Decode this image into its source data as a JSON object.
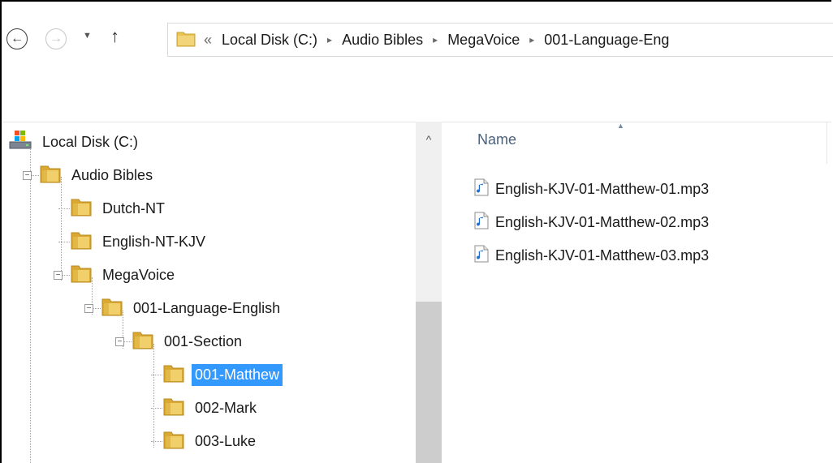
{
  "address_bar": {
    "overflow_chevron": "«",
    "crumbs": [
      "Local Disk (C:)",
      "Audio Bibles",
      "MegaVoice",
      "001-Language-Eng"
    ],
    "separator": "›"
  },
  "icons": {
    "back": "back-arrow-icon",
    "forward": "forward-arrow-icon",
    "recent": "chevron-down-icon",
    "up": "up-arrow-icon",
    "folder": "folder-icon",
    "drive": "drive-icon",
    "audio_file": "audio-file-icon"
  },
  "nav_tree": [
    {
      "label": "Local Disk (C:)",
      "level": 0,
      "type": "drive",
      "expander": "",
      "selected": false
    },
    {
      "label": "Audio Bibles",
      "level": 1,
      "type": "folder",
      "expander": "−",
      "selected": false
    },
    {
      "label": "Dutch-NT",
      "level": 2,
      "type": "folder",
      "expander": "",
      "selected": false
    },
    {
      "label": "English-NT-KJV",
      "level": 2,
      "type": "folder",
      "expander": "",
      "selected": false
    },
    {
      "label": "MegaVoice",
      "level": 2,
      "type": "folder",
      "expander": "−",
      "selected": false
    },
    {
      "label": "001-Language-English",
      "level": 3,
      "type": "folder",
      "expander": "−",
      "selected": false
    },
    {
      "label": "001-Section",
      "level": 4,
      "type": "folder",
      "expander": "−",
      "selected": false
    },
    {
      "label": "001-Matthew",
      "level": 5,
      "type": "folder",
      "expander": "",
      "selected": true
    },
    {
      "label": "002-Mark",
      "level": 5,
      "type": "folder",
      "expander": "",
      "selected": false
    },
    {
      "label": "003-Luke",
      "level": 5,
      "type": "folder",
      "expander": "",
      "selected": false
    }
  ],
  "file_list": {
    "column_header": "Name",
    "files": [
      "English-KJV-01-Matthew-01.mp3",
      "English-KJV-01-Matthew-02.mp3",
      "English-KJV-01-Matthew-03.mp3"
    ]
  },
  "colors": {
    "selection": "#3399ff",
    "folder": "#e8c252",
    "header_text": "#4c607a"
  }
}
